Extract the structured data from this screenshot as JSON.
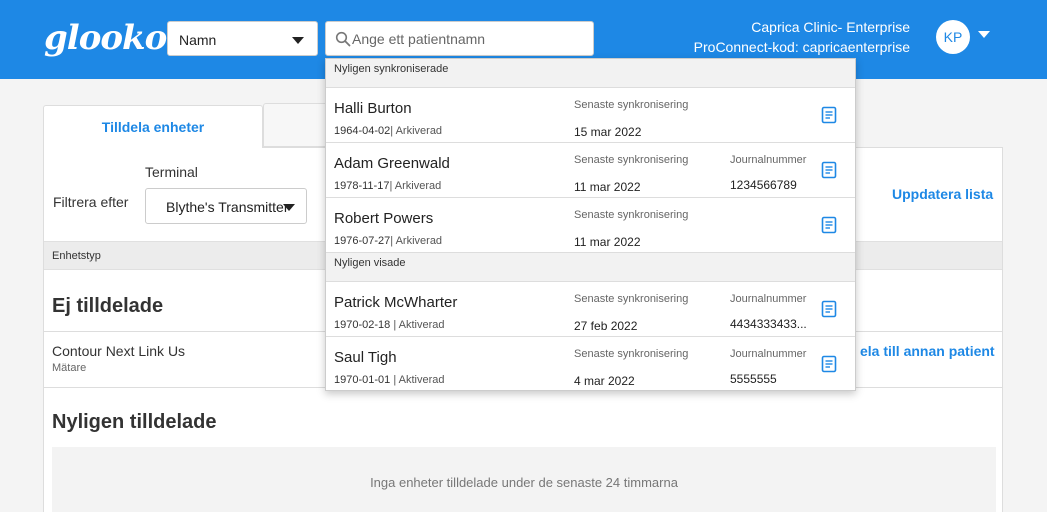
{
  "header": {
    "logo": "glooko",
    "search_type": "Namn",
    "search_placeholder": "Ange ett patientnamn",
    "clinic_name": "Caprica Clinic- Enterprise",
    "proconnect": "ProConnect-kod: capricaenterprise",
    "avatar_initials": "KP",
    "bar_color": "#1e88e5"
  },
  "tabs": {
    "active": "Tilldela enheter"
  },
  "filters": {
    "terminal_label": "Terminal",
    "filter_label": "Filtrera efter",
    "terminal_value": "Blythe's Transmitter",
    "update_link": "Uppdatera lista"
  },
  "table": {
    "type_header": "Enhetstyp",
    "unassigned_heading": "Ej tilldelade",
    "device_name": "Contour Next Link Us",
    "device_type": "Mätare",
    "assign_link": "ela till annan patient",
    "recent_heading": "Nyligen tilldelade",
    "empty_message": "Inga enheter tilldelade under de senaste 24 timmarna"
  },
  "dropdown": {
    "synced_header": "Nyligen synkroniserade",
    "synced": [
      {
        "name": "Halli Burton",
        "dob": "1964-04-02",
        "status": "| Arkiverad",
        "sync_label": "Senaste synkronisering",
        "sync_date": "15 mar 2022",
        "journal_label": "",
        "journal": ""
      },
      {
        "name": "Adam Greenwald",
        "dob": "1978-11-17",
        "status": "| Arkiverad",
        "sync_label": "Senaste synkronisering",
        "sync_date": "11 mar 2022",
        "journal_label": "Journalnummer",
        "journal": "1234566789"
      },
      {
        "name": "Robert Powers",
        "dob": "1976-07-27",
        "status": "| Arkiverad",
        "sync_label": "Senaste synkronisering",
        "sync_date": "11 mar 2022",
        "journal_label": "",
        "journal": ""
      }
    ],
    "viewed_header": "Nyligen visade",
    "viewed": [
      {
        "name": "Patrick McWharter",
        "dob": "1970-02-18",
        "status": " | Aktiverad",
        "sync_label": "Senaste synkronisering",
        "sync_date": "27 feb 2022",
        "journal_label": "Journalnummer",
        "journal": "4434333433..."
      },
      {
        "name": "Saul Tigh",
        "dob": "1970-01-01",
        "status": " | Aktiverad",
        "sync_label": "Senaste synkronisering",
        "sync_date": "4 mar 2022",
        "journal_label": "Journalnummer",
        "journal": "5555555"
      }
    ]
  }
}
